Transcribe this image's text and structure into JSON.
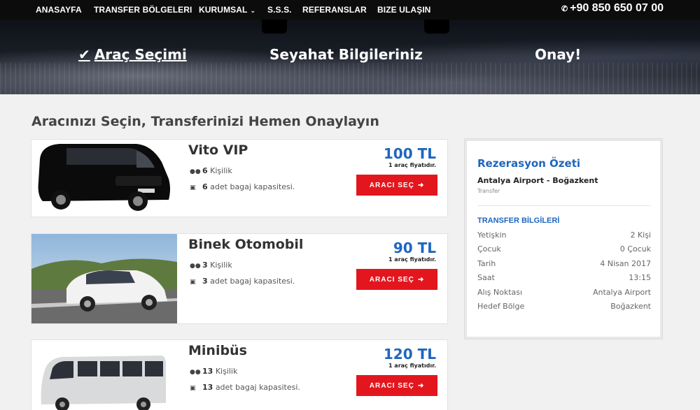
{
  "nav": {
    "items": [
      {
        "label": "ANASAYFA"
      },
      {
        "label": "TRANSFER BÖLGELERI"
      },
      {
        "label": "KURUMSAL"
      },
      {
        "label": "S.S.S."
      },
      {
        "label": "REFERANSLAR"
      },
      {
        "label": "BIZE ULAŞIN"
      }
    ],
    "phone": "+90 850 650 07 00",
    "phone_icon": "phone-icon"
  },
  "steps": [
    {
      "label": "Araç Seçimi",
      "icon": "check-icon",
      "active": true
    },
    {
      "label": "Seyahat Bilgileriniz"
    },
    {
      "label": "Onay!"
    }
  ],
  "main": {
    "title": "Aracınızı Seçin, Transferinizi Hemen Onaylayın"
  },
  "vehicles": [
    {
      "name": "Vito VIP",
      "capacity": "6",
      "capacity_label": "Kişilik",
      "luggage": "6",
      "luggage_label": "adet bagaj kapasitesi.",
      "price": "100 TL",
      "price_note": "1 araç fiyatıdır.",
      "button": "ARACI SEÇ"
    },
    {
      "name": "Binek Otomobil",
      "capacity": "3",
      "capacity_label": "Kişilik",
      "luggage": "3",
      "luggage_label": "adet bagaj kapasitesi.",
      "price": "90 TL",
      "price_note": "1 araç fiyatıdır.",
      "button": "ARACI SEÇ"
    },
    {
      "name": "Minibüs",
      "capacity": "13",
      "capacity_label": "Kişilik",
      "luggage": "13",
      "luggage_label": "adet bagaj kapasitesi.",
      "price": "120 TL",
      "price_note": "1 araç fiyatıdır.",
      "button": "ARACI SEÇ"
    }
  ],
  "summary": {
    "title": "Rezerasyon Özeti",
    "route": "Antalya Airport - Boğazkent",
    "type": "Transfer",
    "section": "TRANSFER BİLGİLERİ",
    "rows": [
      {
        "label": "Yetişkin",
        "value": "2 Kişi"
      },
      {
        "label": "Çocuk",
        "value": "0 Çocuk"
      },
      {
        "label": "Tarih",
        "value": "4 Nisan 2017"
      },
      {
        "label": "Saat",
        "value": "13:15"
      },
      {
        "label": "Alış Noktası",
        "value": "Antalya Airport"
      },
      {
        "label": "Hedef Bölge",
        "value": "Boğazkent"
      }
    ]
  },
  "colors": {
    "accent_blue": "#1f66bd",
    "button_red": "#e3161e",
    "nav_bg": "#0c0c0c"
  }
}
